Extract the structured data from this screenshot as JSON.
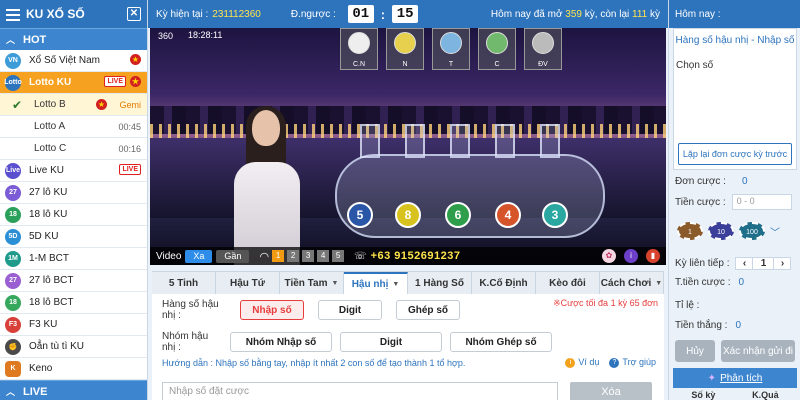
{
  "sidebar": {
    "title": "KU XỔ SỐ",
    "hot_label": "HOT",
    "live_label": "LIVE",
    "items": [
      {
        "label": "Xổ Số Việt Nam",
        "icon": "vn-lottery-icon"
      },
      {
        "label": "Lotto KU",
        "live": "LIVE",
        "icon": "lotto-icon"
      },
      {
        "label": "Lotto B",
        "extra": "Gemi"
      },
      {
        "label": "Lotto A",
        "time": "00:45"
      },
      {
        "label": "Lotto C",
        "time": "00:16"
      },
      {
        "label": "Live KU",
        "live": "LIVE",
        "icon": "live-icon"
      },
      {
        "label": "27 lô KU",
        "icon": "27-icon"
      },
      {
        "label": "18 lô KU",
        "icon": "18-icon"
      },
      {
        "label": "5D KU",
        "icon": "5d-icon"
      },
      {
        "label": "1-M BCT",
        "icon": "1m-icon"
      },
      {
        "label": "27 lô BCT",
        "icon": "27bct-icon"
      },
      {
        "label": "18 lô BCT",
        "icon": "18bct-icon"
      },
      {
        "label": "F3 KU",
        "icon": "f3-icon"
      },
      {
        "label": "Oẳn tù tì KU",
        "icon": "rps-icon"
      },
      {
        "label": "Keno",
        "icon": "keno-icon"
      }
    ]
  },
  "topbar": {
    "period_label": "Kỳ hiện tại :",
    "period": "231112360",
    "countdown_label": "Đ.ngược :",
    "minutes": "01",
    "seconds": "15",
    "today_prefix": "Hôm nay đã mở",
    "opened": "359",
    "today_mid": "kỳ, còn lại",
    "remaining": "111",
    "today_suffix": "kỳ"
  },
  "video": {
    "overlay_channel": "360",
    "overlay_time": "18:28:11",
    "header_balls": [
      "C.N",
      "N",
      "T",
      "C",
      "ĐV"
    ],
    "balls": [
      "5",
      "8",
      "6",
      "4",
      "3"
    ],
    "video_label": "Video",
    "btn_xa": "Xa",
    "btn_gan": "Gần",
    "numbers": [
      "1",
      "2",
      "3",
      "4",
      "5"
    ],
    "phone": "+63 9152691237"
  },
  "tabs": [
    {
      "label": "5 Tinh"
    },
    {
      "label": "Hậu Tứ"
    },
    {
      "label": "Tiền Tam",
      "dd": true
    },
    {
      "label": "Hậu nhị",
      "dd": true
    },
    {
      "label": "1 Hàng Số"
    },
    {
      "label": "K.Cố Định"
    },
    {
      "label": "Kèo đôi"
    },
    {
      "label": "Cách Chơi",
      "dd": true
    }
  ],
  "controls": {
    "row1_label": "Hàng số hậu nhị :",
    "row1_buttons": [
      "Nhập số",
      "Digit",
      "Ghép số"
    ],
    "row2_label": "Nhóm hậu nhị :",
    "row2_buttons": [
      "Nhóm Nhập số",
      "Digit",
      "Nhóm Ghép số"
    ],
    "note": "※Cược tối đa 1 kỳ 65 đơn",
    "guide": "Hướng dẫn : Nhập số bằng tay, nhập ít nhất 2 con số để tạo thành 1 tổ hợp.",
    "link_example": "Ví dụ",
    "link_help": "Trợ giúp",
    "input_placeholder": "Nhập số đặt cược",
    "clear_label": "Xóa"
  },
  "right": {
    "today_label": "Hôm nay :",
    "panel_title": "Hàng số hậu nhị - Nhập số",
    "choose_label": "Chọn số",
    "repeat_label": "Lặp lại đơn cược kỳ trước",
    "don_cuoc_label": "Đơn cược :",
    "don_cuoc_value": "0",
    "tien_cuoc_label": "Tiền cược :",
    "tien_cuoc_placeholder": "0 - 0",
    "chips": [
      "1",
      "10",
      "100"
    ],
    "ky_lien_tiep_label": "Kỳ liên tiếp :",
    "ky_lien_tiep_value": "1",
    "t_tien_cuoc_label": "T.tiền cược :",
    "t_tien_cuoc_value": "0",
    "ti_le_label": "Tỉ lệ :",
    "tien_thang_label": "Tiền thắng :",
    "tien_thang_value": "0",
    "cancel_label": "Hủy",
    "confirm_label": "Xác nhận gửi đi",
    "analysis_label": "Phân tích",
    "col1": "Số kỳ",
    "col2": "K.Quả"
  },
  "colors": {
    "brand": "#2e74bd",
    "accent": "#f6a11f",
    "alert": "#e63c3c"
  }
}
